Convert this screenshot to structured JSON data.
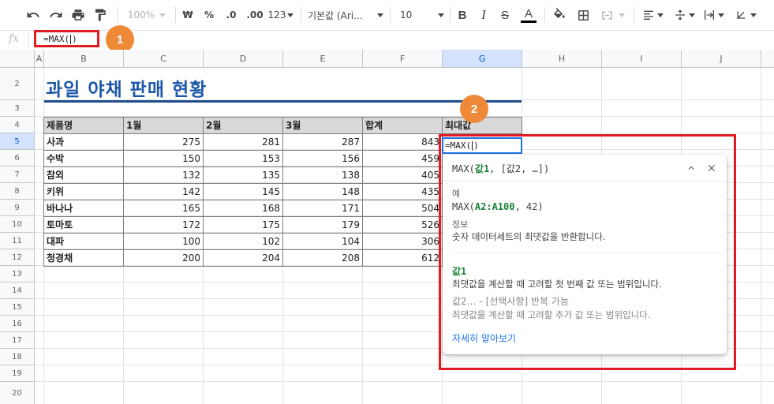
{
  "toolbar": {
    "zoom": "100%",
    "currency": "₩",
    "percent": "%",
    "decrease_decimal": ".0",
    "increase_decimal": ".00",
    "more_formats": "123",
    "font_family": "기본값 (Ari...",
    "font_size": "10",
    "text_color_accent": "#000000"
  },
  "formula_bar": {
    "fx": "fx",
    "content": "=MAX(",
    "content_end": ")"
  },
  "badges": {
    "one": "1",
    "two": "2"
  },
  "columns": [
    "A",
    "B",
    "C",
    "D",
    "E",
    "F",
    "G",
    "H",
    "I",
    "J"
  ],
  "rows": [
    "2",
    "3",
    "4",
    "5",
    "6",
    "7",
    "8",
    "9",
    "10",
    "11",
    "12",
    "13",
    "14",
    "15",
    "16",
    "17",
    "18",
    "19",
    "20"
  ],
  "sheet": {
    "title": "과일 야채 판매 현황",
    "headers": [
      "제품명",
      "1월",
      "2월",
      "3월",
      "합계",
      "최대값"
    ],
    "data": [
      [
        "사과",
        "275",
        "281",
        "287",
        "843"
      ],
      [
        "수박",
        "150",
        "153",
        "156",
        "459"
      ],
      [
        "참외",
        "132",
        "135",
        "138",
        "405"
      ],
      [
        "키위",
        "142",
        "145",
        "148",
        "435"
      ],
      [
        "바나나",
        "165",
        "168",
        "171",
        "504"
      ],
      [
        "토마토",
        "172",
        "175",
        "179",
        "526"
      ],
      [
        "대파",
        "100",
        "102",
        "104",
        "306"
      ],
      [
        "청경채",
        "200",
        "204",
        "208",
        "612"
      ]
    ],
    "active_cell_prefix": "=MAX(",
    "active_cell_suffix": ")"
  },
  "help": {
    "fn": "MAX(",
    "arg1": "값1",
    "rest": ", [값2, …])",
    "example_label": "예",
    "example_fn": "MAX(",
    "example_range": "A2:A100",
    "example_rest": ", 42)",
    "info_label": "정보",
    "info_text": "숫자 데이터세트의 최댓값을 반환합니다.",
    "arg1_name": "값1",
    "arg1_desc": "최댓값을 계산할 때 고려할 첫 번째 값 또는 범위입니다.",
    "arg2_name": "값2… - [선택사항] 반복 가능",
    "arg2_desc": "최댓값을 계산할 때 고려할 추가 값 또는 범위입니다.",
    "learn_more": "자세히 알아보기"
  },
  "colors": {
    "title": "#1c58a8",
    "annotation_border": "#e01b24",
    "badge": "#ee8a37",
    "selection": "#1a73e8",
    "argument_green": "#188038"
  }
}
